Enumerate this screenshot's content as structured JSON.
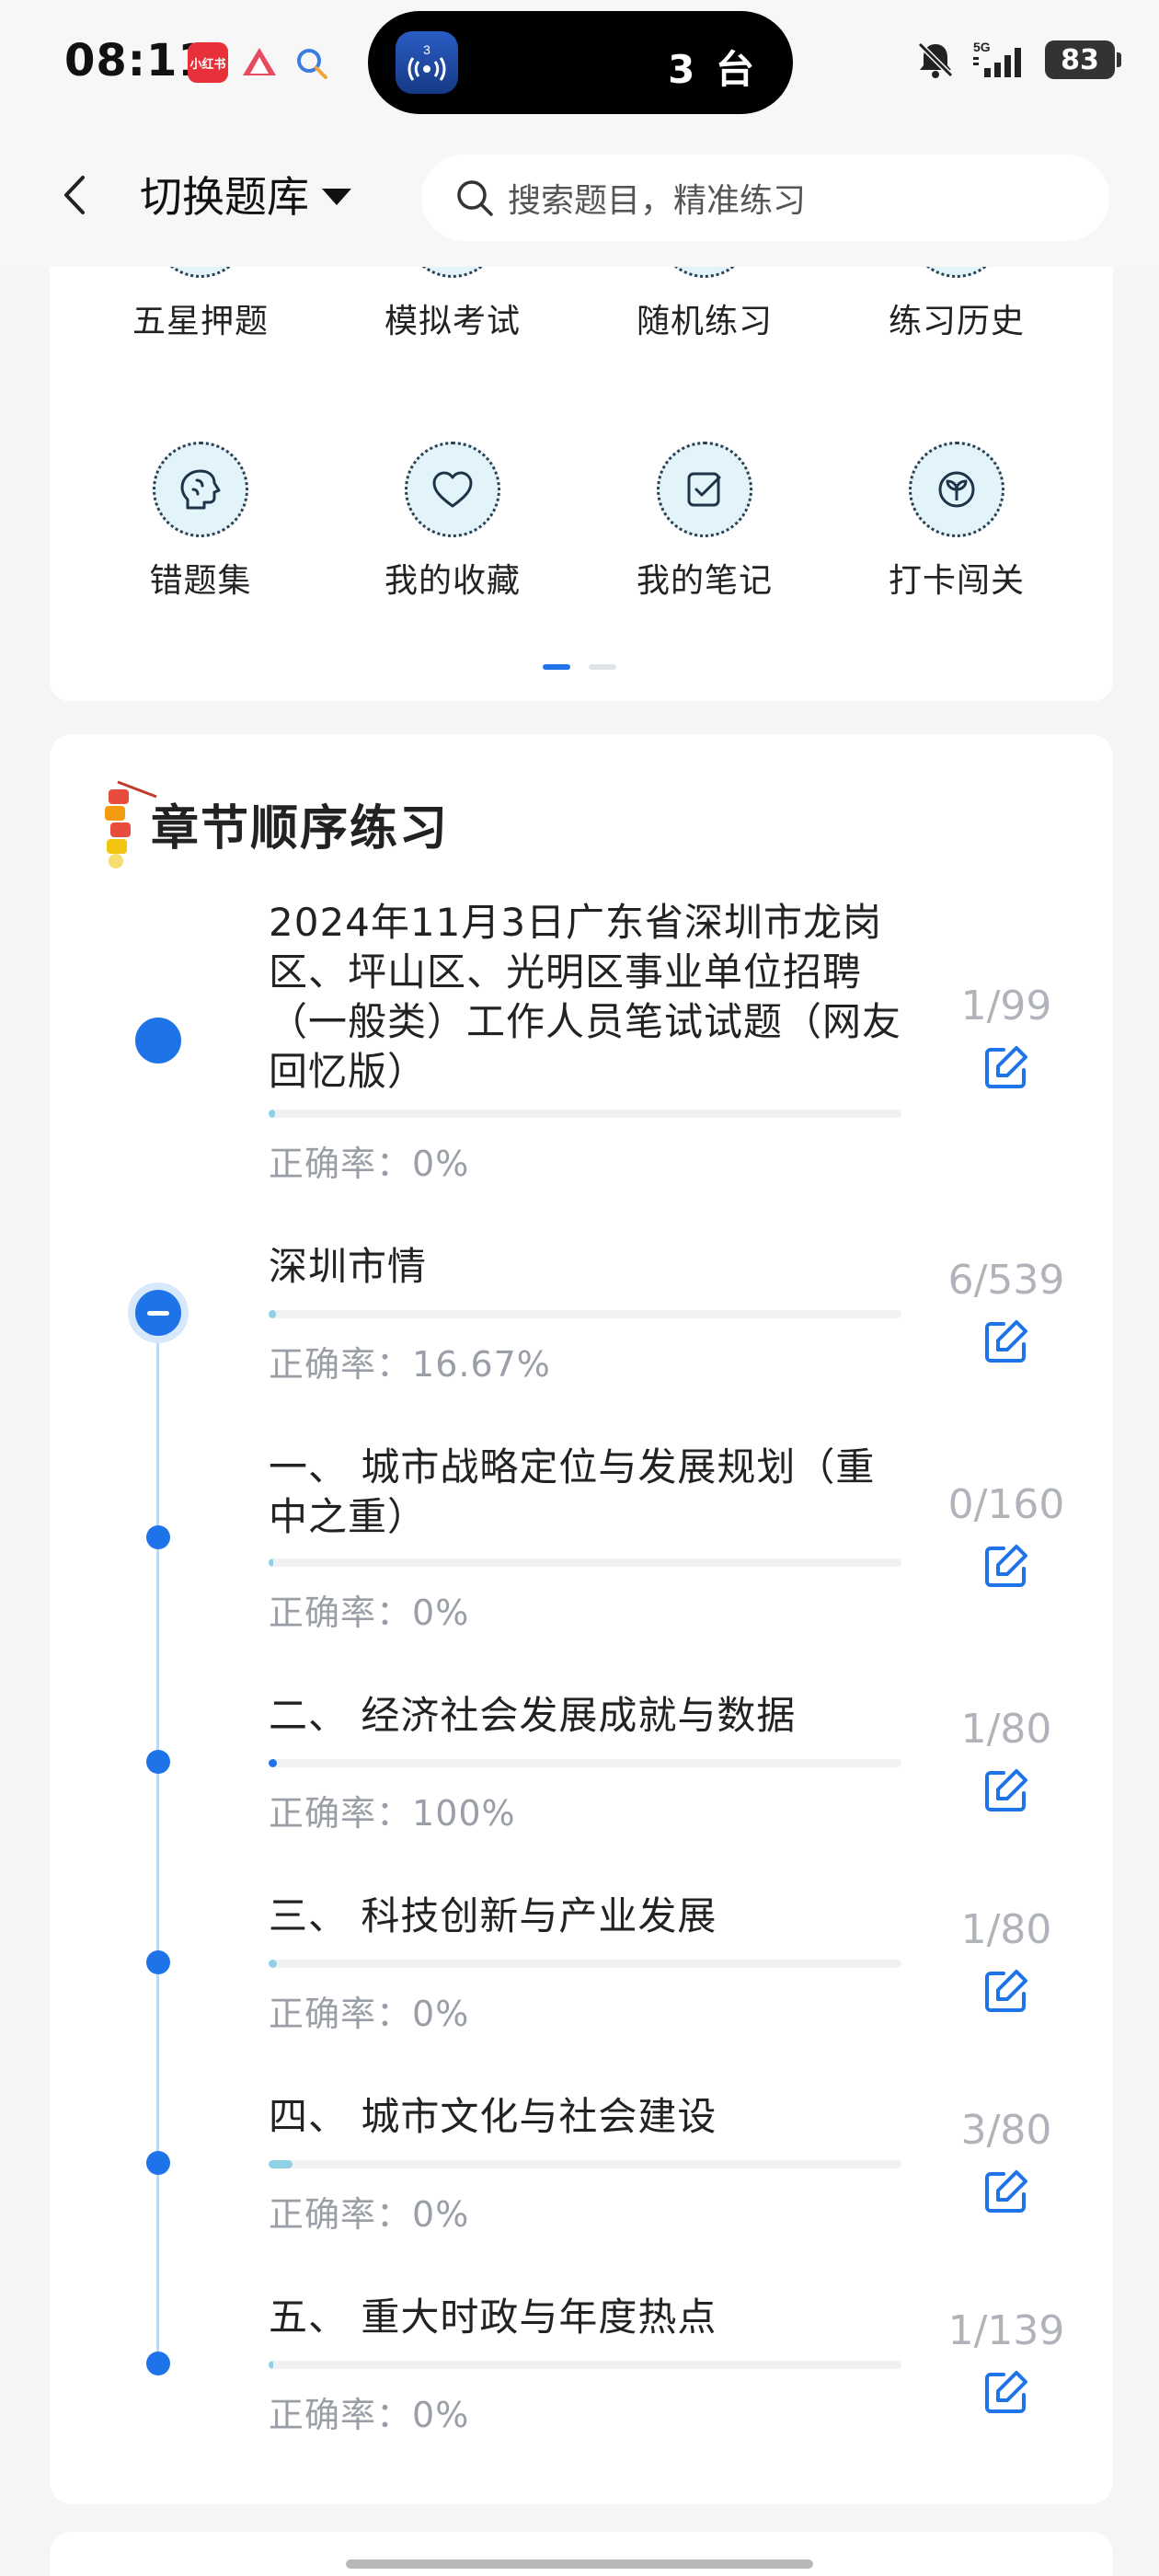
{
  "status_bar": {
    "time": "08:11",
    "app_badge": "小红书",
    "island_badge": "3",
    "island_text": "3 台",
    "network": "5G",
    "battery": "83"
  },
  "header": {
    "switch_label": "切换题库",
    "search_placeholder": "搜索题目，精准练习"
  },
  "quick_grid": {
    "items": [
      {
        "label": "五星押题",
        "icon": "star-icon"
      },
      {
        "label": "模拟考试",
        "icon": "exam-icon"
      },
      {
        "label": "随机练习",
        "icon": "shuffle-icon"
      },
      {
        "label": "练习历史",
        "icon": "history-icon"
      },
      {
        "label": "错题集",
        "icon": "brain-icon"
      },
      {
        "label": "我的收藏",
        "icon": "heart-icon"
      },
      {
        "label": "我的笔记",
        "icon": "note-check-icon"
      },
      {
        "label": "打卡闯关",
        "icon": "sprout-icon"
      }
    ],
    "page_count": 2,
    "active_page": 1
  },
  "chapter": {
    "title": "章节顺序练习",
    "accuracy_prefix": "正确率：",
    "rows": [
      {
        "title": "2024年11月3日广东省深圳市龙岗区、坪山区、光明区事业单位招聘（一般类）工作人员笔试试题（网友回忆版）",
        "accuracy": "0%",
        "count": "1/99",
        "progress": 0.01
      },
      {
        "title": "深圳市情",
        "accuracy": "16.67%",
        "count": "6/539",
        "progress": 0.011
      },
      {
        "title": "一、 城市战略定位与发展规划（重中之重）",
        "accuracy": "0%",
        "count": "0/160",
        "progress": 0.0
      },
      {
        "title": "二、 经济社会发展成就与数据",
        "accuracy": "100%",
        "count": "1/80",
        "progress": 0.0125
      },
      {
        "title": "三、 科技创新与产业发展",
        "accuracy": "0%",
        "count": "1/80",
        "progress": 0.0125
      },
      {
        "title": "四、 城市文化与社会建设",
        "accuracy": "0%",
        "count": "3/80",
        "progress": 0.0375
      },
      {
        "title": "五、 重大时政与年度热点",
        "accuracy": "0%",
        "count": "1/139",
        "progress": 0.007
      }
    ]
  }
}
